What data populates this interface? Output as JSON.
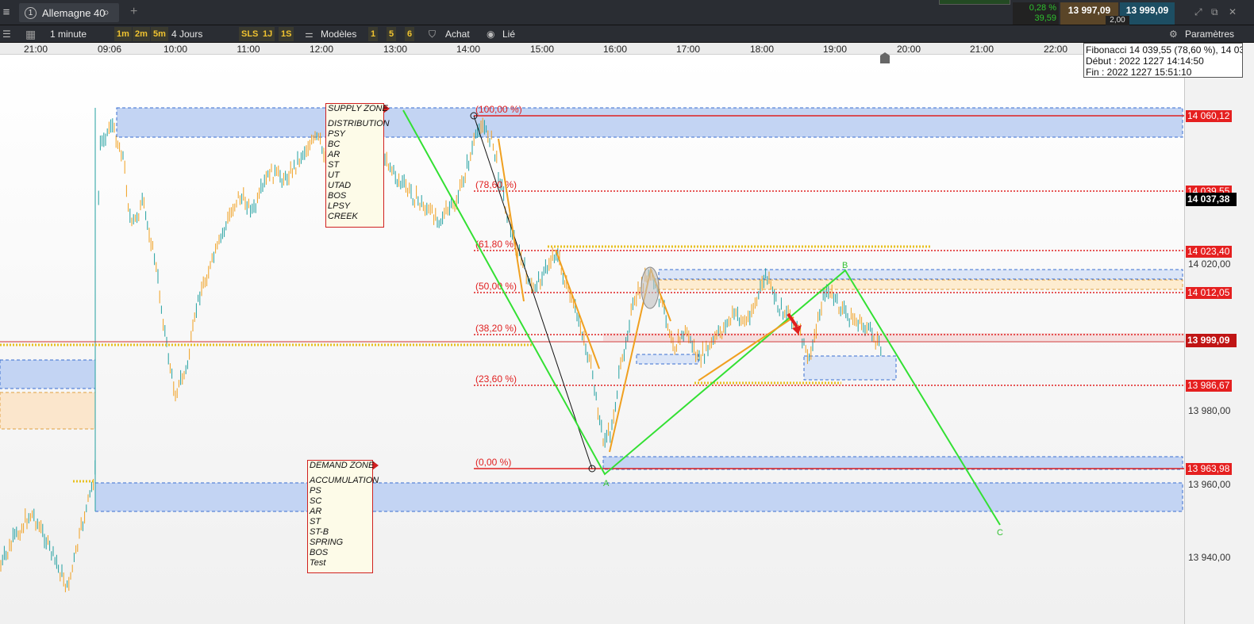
{
  "topbar": {
    "instrument_number": "1",
    "instrument_name": "Allemagne 40",
    "change_pct": "0,28 %",
    "change_abs": "39,59",
    "bid": "13 997,09",
    "ask": "13 999,09",
    "spread": "2,00"
  },
  "toolbar": {
    "interval": "1 minute",
    "tf_1m": "1m",
    "tf_2m": "2m",
    "tf_5m": "5m",
    "range": "4 Jours",
    "sls": "SLS",
    "one_j": "1J",
    "one_s": "1S",
    "models": "Modèles",
    "n1": "1",
    "n5": "5",
    "n6": "6",
    "buy": "Achat",
    "linked": "Lié",
    "settings": "Paramètres"
  },
  "time_axis": [
    "21:00",
    "09:06",
    "10:00",
    "11:00",
    "12:00",
    "13:00",
    "14:00",
    "15:00",
    "16:00",
    "17:00",
    "18:00",
    "19:00",
    "20:00",
    "21:00",
    "22:00"
  ],
  "price_axis": [
    "14 020,00",
    "13 980,00",
    "13 960,00",
    "13 940,00"
  ],
  "price_tags": {
    "fib100": "14 060,12",
    "fib786": "14 039,55",
    "fib618": "14 023,40",
    "fib50": "14 012,05",
    "fib236": "13 986,67",
    "fib0": "13 963,98",
    "current": "13 999,09",
    "crosshair": "14 037,38"
  },
  "fib_levels": [
    "(100,00 %)",
    "(78,60 %)",
    "(61,80 %)",
    "(50,00 %)",
    "(38,20 %)",
    "(23,60 %)",
    "(0,00 %)"
  ],
  "info": {
    "line1": "Fibonacci 14 039,55 (78,60 %), 14 03",
    "line2": "Début : 2022 1227 14:14:50",
    "line3": "Fin : 2022 1227 15:51:10"
  },
  "supply": {
    "title": "SUPPLY ZONE",
    "items": [
      "DISTRIBUTION",
      "PSY",
      "BC",
      "AR",
      "ST",
      "UT",
      "UTAD",
      "BOS",
      "LPSY",
      "CREEK"
    ]
  },
  "demand": {
    "title": "DEMAND ZONE",
    "items": [
      "ACCUMULATION",
      "PS",
      "SC",
      "AR",
      "ST",
      "ST-B",
      "SPRING",
      "BOS",
      "Test"
    ]
  },
  "wave_labels": {
    "a": "A",
    "b": "B",
    "c": "C"
  },
  "colors": {
    "bull": "#22a0a0",
    "bear": "#f0a020",
    "zone": "#c8d8f4",
    "fib": "#e02020",
    "wave": "#33e033"
  }
}
